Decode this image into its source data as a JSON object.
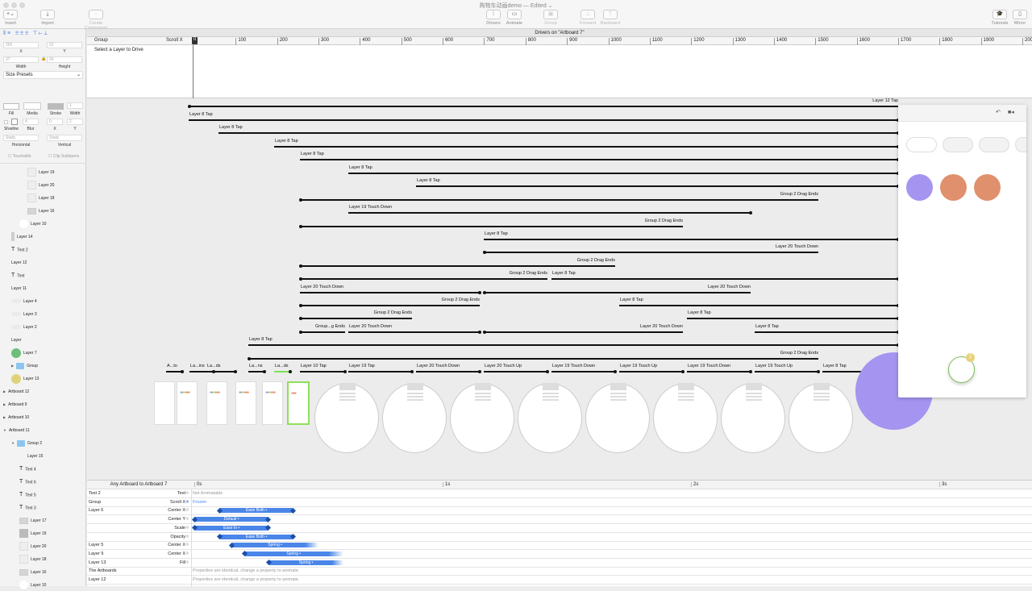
{
  "window": {
    "title": "购物车动画demo",
    "status": "— Edited ⌄"
  },
  "toolbar": {
    "left": [
      {
        "label": "Insert",
        "icon": "+⌄"
      },
      {
        "label": "Import",
        "icon": "⤓"
      },
      {
        "label": "Create Component",
        "icon": "◦",
        "disabled": true
      }
    ],
    "center": [
      {
        "label": "Drivers",
        "icon": "⁞"
      },
      {
        "label": "Animate",
        "icon": "▭"
      },
      {
        "label": "Group",
        "icon": "▣",
        "disabled": true
      },
      {
        "label": "Forward",
        "icon": "⊥",
        "disabled": true
      },
      {
        "label": "Backward",
        "icon": "⊤",
        "disabled": true
      }
    ],
    "right": [
      {
        "label": "Tutorials",
        "icon": "🎓"
      },
      {
        "label": "Mirror",
        "icon": "▯"
      }
    ]
  },
  "inspector": {
    "x": "255",
    "y": "22",
    "x_label": "X",
    "y_label": "Y",
    "width": "27",
    "height": "26",
    "width_label": "Width",
    "height_label": "Height",
    "size_presets": "Size Presets",
    "fill_label": "Fill",
    "media_label": "Media",
    "stroke_label": "Stroke",
    "stroke_width": "1",
    "stroke_width_label": "Width",
    "shadow_label": "Shadow",
    "blur": "4",
    "blur_label": "Blur",
    "shadow_x": "0",
    "shadow_x_label": "X",
    "shadow_y": "2",
    "shadow_y_label": "Y",
    "horizontal": "Static",
    "horizontal_label": "Horizontal",
    "vertical": "Static",
    "vertical_label": "Vertical",
    "touchable": "Touchable",
    "clip_sublayers": "Clip Sublayers"
  },
  "layers": [
    {
      "name": "Layer 19",
      "indent": 3,
      "thumb": "box"
    },
    {
      "name": "Layer 20",
      "indent": 3,
      "thumb": "box"
    },
    {
      "name": "Layer 18",
      "indent": 3,
      "thumb": "box"
    },
    {
      "name": "Layer 16",
      "indent": 3,
      "thumb": "boxdark"
    },
    {
      "name": "Layer 10",
      "indent": 2,
      "thumb": "circle"
    },
    {
      "name": "Layer 14",
      "indent": 1,
      "thumb": "bar"
    },
    {
      "name": "Text 2",
      "indent": 1,
      "thumb": "text"
    },
    {
      "name": "Layer 12",
      "indent": 1,
      "thumb": "none"
    },
    {
      "name": "Text",
      "indent": 1,
      "thumb": "text"
    },
    {
      "name": "Layer 11",
      "indent": 1,
      "thumb": "none"
    },
    {
      "name": "Layer 4",
      "indent": 1,
      "thumb": "pill"
    },
    {
      "name": "Layer 3",
      "indent": 1,
      "thumb": "pill"
    },
    {
      "name": "Layer 2",
      "indent": 1,
      "thumb": "pill"
    },
    {
      "name": "Layer",
      "indent": 1,
      "thumb": "none"
    },
    {
      "name": "Layer 7",
      "indent": 1,
      "thumb": "green"
    },
    {
      "name": "Group",
      "indent": 1,
      "thumb": "folder",
      "disclosure": "▶"
    },
    {
      "name": "Layer 13",
      "indent": 1,
      "thumb": "yellow"
    },
    {
      "name": "Artboard 12",
      "indent": 0,
      "thumb": "none",
      "disclosure": "▶"
    },
    {
      "name": "Artboard 9",
      "indent": 0,
      "thumb": "none",
      "disclosure": "▶"
    },
    {
      "name": "Artboard 10",
      "indent": 0,
      "thumb": "none",
      "disclosure": "▶"
    },
    {
      "name": "Artboard 11",
      "indent": 0,
      "thumb": "none",
      "disclosure": "▼"
    },
    {
      "name": "Group 2",
      "indent": 1,
      "thumb": "folder",
      "disclosure": "▼"
    },
    {
      "name": "Layer 15",
      "indent": 3,
      "thumb": "none"
    },
    {
      "name": "Text 4",
      "indent": 2,
      "thumb": "text"
    },
    {
      "name": "Text 6",
      "indent": 2,
      "thumb": "text"
    },
    {
      "name": "Text 5",
      "indent": 2,
      "thumb": "text"
    },
    {
      "name": "Text 3",
      "indent": 2,
      "thumb": "text"
    },
    {
      "name": "Layer 17",
      "indent": 2,
      "thumb": "boxdark"
    },
    {
      "name": "Layer 19",
      "indent": 2,
      "thumb": "boxdot"
    },
    {
      "name": "Layer 20",
      "indent": 2,
      "thumb": "box"
    },
    {
      "name": "Layer 18",
      "indent": 2,
      "thumb": "box"
    },
    {
      "name": "Layer 16",
      "indent": 2,
      "thumb": "boxdark"
    },
    {
      "name": "Layer 10",
      "indent": 2,
      "thumb": "circle"
    }
  ],
  "drivers": {
    "header": "Drivers on \"Artboard 7\"",
    "col_group": "Group",
    "col_property": "Scroll X",
    "playhead": "0",
    "ruler": [
      "100",
      "200",
      "300",
      "400",
      "500",
      "600",
      "700",
      "800",
      "900",
      "1000",
      "1100",
      "1200",
      "1300",
      "1400",
      "1500",
      "1600",
      "1700",
      "1800",
      "1900",
      "2000"
    ],
    "empty": "Select a Layer to Drive"
  },
  "connections": [
    "Layer 12 Tap",
    "Layer 8 Tap",
    "Layer 8 Tap",
    "Layer 8 Tap",
    "Layer 8 Tap",
    "Layer 8 Tap",
    "Layer 8 Tap",
    "Group 2 Drag Ends",
    "Layer 19 Touch Down",
    "Group 2 Drag Ends",
    "Layer 8 Tap",
    "Layer 20 Touch Down",
    "Group 2 Drag Ends",
    "Group 2 Drag Ends",
    "Layer 8 Tap",
    "Layer 20 Touch Down",
    "Layer 20 Touch Down",
    "Group 2 Drag Ends",
    "Layer 8 Tap",
    "Group 2 Drag Ends",
    "Layer 8 Tap",
    "Group...g Ends",
    "Layer 20 Touch Down",
    "Layer 20 Touch Down",
    "Layer 8 Tap",
    "Layer 8 Tap",
    "Group 2 Drag Ends",
    "A...to",
    "La...ins",
    "La...ds",
    "La...ns",
    "La...ds",
    "Layer 10 Tap",
    "Layer 19 Tap",
    "Layer 20 Touch Down",
    "Layer 20 Touch Up",
    "Layer 19 Touch Down",
    "Layer 19 Touch Up",
    "Layer 19 Touch Down",
    "Layer 19 Touch Up",
    "Layer 8 Tap"
  ],
  "preview": {
    "badge": "2",
    "colors": {
      "purple": "#a594f0",
      "orange": "#e0906c",
      "green": "#7cc05a",
      "badge": "#e6d27a"
    }
  },
  "timeline": {
    "header": "Any Artboard to Artboard 7",
    "ticks": [
      "0s",
      "1s",
      "2s",
      "3s"
    ],
    "rows": [
      {
        "layer": "Text 2",
        "property": "Text",
        "note": "Not Animatable"
      },
      {
        "layer": "Group",
        "property": "Scroll X",
        "note": "Frozen",
        "frozen": true
      },
      {
        "layer": "Layer 6",
        "property": "Center X",
        "curve": "Ease Both •",
        "start": 0.1,
        "end": 0.4
      },
      {
        "layer": "",
        "property": "Center Y",
        "curve": "Default •",
        "start": 0,
        "end": 0.3
      },
      {
        "layer": "",
        "property": "Scale",
        "curve": "Ease In •",
        "start": 0,
        "end": 0.3
      },
      {
        "layer": "",
        "property": "Opacity",
        "curve": "Ease Both •",
        "start": 0.1,
        "end": 0.4
      },
      {
        "layer": "Layer 5",
        "property": "Center X",
        "curve": "Spring •",
        "start": 0.15,
        "end": 0.5,
        "spring": true
      },
      {
        "layer": "Layer 9",
        "property": "Center X",
        "curve": "Spring •",
        "start": 0.2,
        "end": 0.6,
        "spring": true
      },
      {
        "layer": "Layer 13",
        "property": "Fill",
        "curve": "Spring •",
        "start": 0.3,
        "end": 0.6,
        "spring": true
      },
      {
        "layer": "The Artboards",
        "property": "",
        "note": "Properties are identical, change a property to animate."
      },
      {
        "layer": "Layer 12",
        "property": "",
        "note": "Properties are identical, change a property to animate."
      }
    ]
  }
}
